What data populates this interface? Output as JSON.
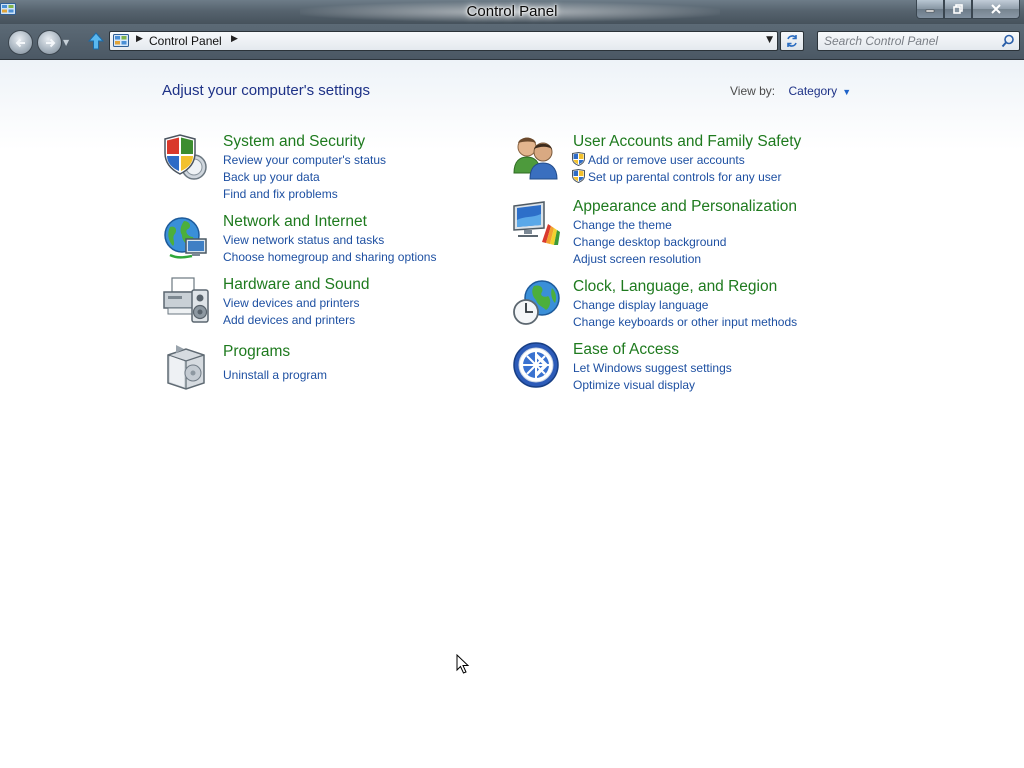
{
  "window": {
    "title": "Control Panel"
  },
  "navigation": {
    "breadcrumb": "Control Panel",
    "search_placeholder": "Search Control Panel"
  },
  "header": {
    "title": "Adjust your computer's settings",
    "view_by_label": "View by:",
    "view_by_value": "Category"
  },
  "categories": [
    {
      "title": "System and Security",
      "icon": "shield-icon",
      "links": [
        "Review your computer's status",
        "Back up your data",
        "Find and fix problems"
      ]
    },
    {
      "title": "Network and Internet",
      "icon": "network-globe-icon",
      "links": [
        "View network status and tasks",
        "Choose homegroup and sharing options"
      ]
    },
    {
      "title": "Hardware and Sound",
      "icon": "printer-speaker-icon",
      "links": [
        "View devices and printers",
        "Add devices and printers"
      ]
    },
    {
      "title": "Programs",
      "icon": "programs-box-icon",
      "links": [
        "Uninstall a program"
      ]
    },
    {
      "title": "User Accounts and Family Safety",
      "icon": "users-icon",
      "links": [
        "Add or remove user accounts",
        "Set up parental controls for any user"
      ]
    },
    {
      "title": "Appearance and Personalization",
      "icon": "monitor-palette-icon",
      "links": [
        "Change the theme",
        "Change desktop background",
        "Adjust screen resolution"
      ]
    },
    {
      "title": "Clock, Language, and Region",
      "icon": "clock-globe-icon",
      "links": [
        "Change display language",
        "Change keyboards or other input methods"
      ]
    },
    {
      "title": "Ease of Access",
      "icon": "ease-of-access-icon",
      "links": [
        "Let Windows suggest settings",
        "Optimize visual display"
      ]
    }
  ],
  "colors": {
    "category_title": "#1e7a1e",
    "link": "#1e50a2",
    "page_title": "#1e3287"
  }
}
